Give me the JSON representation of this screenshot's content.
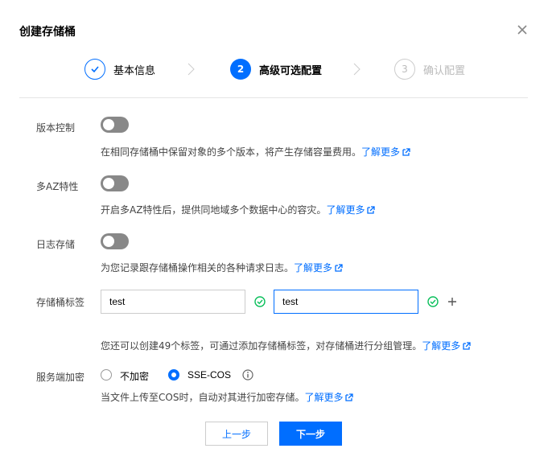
{
  "dialog": {
    "title": "创建存储桶",
    "close_icon": "close-icon"
  },
  "steps": [
    {
      "number": "1",
      "label": "基本信息",
      "status": "done"
    },
    {
      "number": "2",
      "label": "高级可选配置",
      "status": "active"
    },
    {
      "number": "3",
      "label": "确认配置",
      "status": "todo"
    }
  ],
  "versioning": {
    "label": "版本控制",
    "enabled": false,
    "desc": "在相同存储桶中保留对象的多个版本，将产生存储容量费用。",
    "link": "了解更多"
  },
  "multi_az": {
    "label": "多AZ特性",
    "enabled": false,
    "desc": "开启多AZ特性后，提供同地域多个数据中心的容灾。",
    "link": "了解更多"
  },
  "logging": {
    "label": "日志存储",
    "enabled": false,
    "desc": "为您记录跟存储桶操作相关的各种请求日志。",
    "link": "了解更多"
  },
  "tags": {
    "label": "存储桶标签",
    "key_value": "test",
    "value_value": "test",
    "desc": "您还可以创建49个标签，可通过添加存储桶标签，对存储桶进行分组管理。",
    "link": "了解更多"
  },
  "encryption": {
    "label": "服务端加密",
    "options": [
      "不加密",
      "SSE-COS"
    ],
    "selected": "SSE-COS",
    "desc": "当文件上传至COS时，自动对其进行加密存储。",
    "link": "了解更多"
  },
  "buttons": {
    "prev": "上一步",
    "next": "下一步"
  },
  "colors": {
    "primary": "#006eff",
    "success": "#0abf5b",
    "toggle_off": "#888888"
  }
}
